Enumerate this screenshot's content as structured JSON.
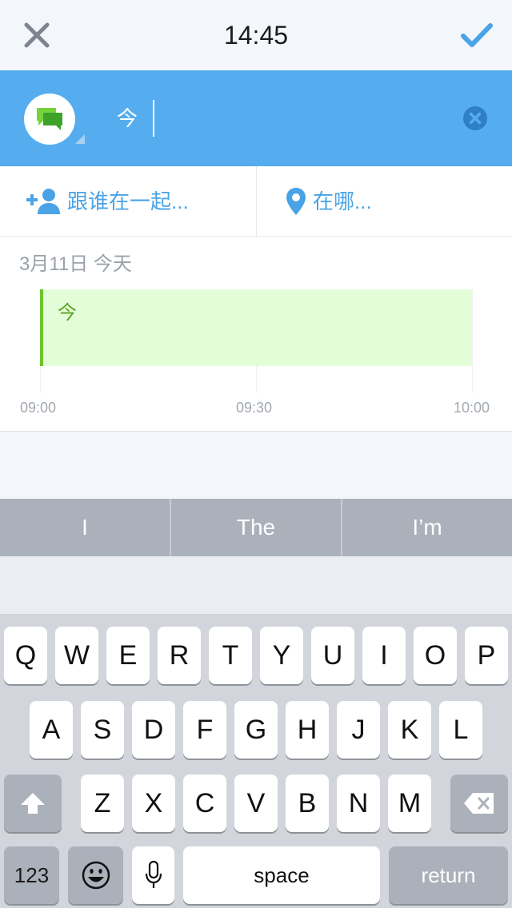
{
  "status": {
    "time": "14:45"
  },
  "input": {
    "title_text": "今",
    "type_icon": "chat-bubbles-icon"
  },
  "options": {
    "with_label": "跟谁在一起...",
    "where_label": "在哪..."
  },
  "timeline": {
    "date_label": "3月11日 今天",
    "event_title": "今",
    "ticks": [
      "09:00",
      "09:30",
      "10:00"
    ]
  },
  "suggestions": [
    "I",
    "The",
    "I’m"
  ],
  "keyboard": {
    "row1": [
      "Q",
      "W",
      "E",
      "R",
      "T",
      "Y",
      "U",
      "I",
      "O",
      "P"
    ],
    "row2": [
      "A",
      "S",
      "D",
      "F",
      "G",
      "H",
      "J",
      "K",
      "L"
    ],
    "row3": [
      "Z",
      "X",
      "C",
      "V",
      "B",
      "N",
      "M"
    ],
    "numbers_label": "123",
    "space_label": "space",
    "return_label": "return"
  },
  "colors": {
    "accent_blue": "#55adef",
    "event_green": "#6cc52c",
    "event_fill": "#e2fdd8"
  }
}
